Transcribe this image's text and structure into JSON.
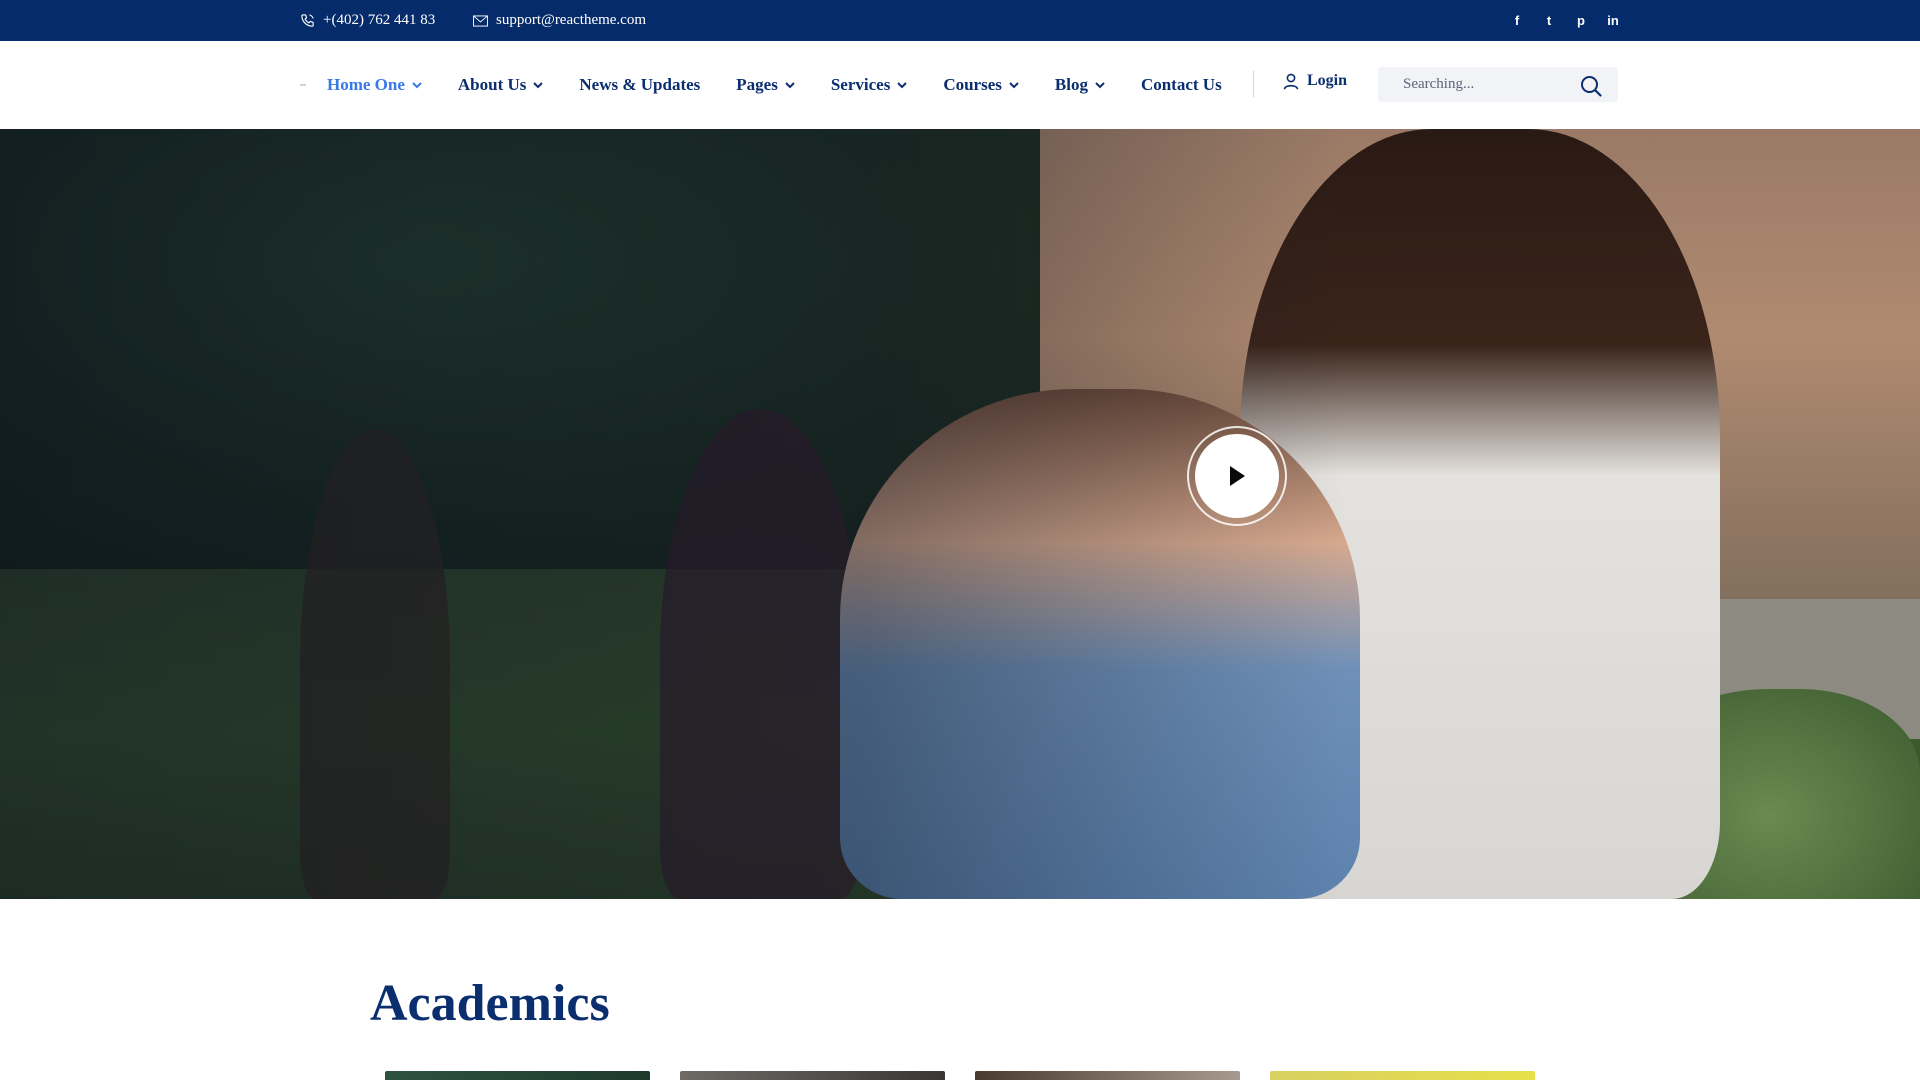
{
  "topbar": {
    "phone": "+(402) 762 441 83",
    "email": "support@reactheme.com",
    "social": [
      {
        "icon": "facebook-icon",
        "glyph": "f"
      },
      {
        "icon": "twitter-icon",
        "glyph": "t"
      },
      {
        "icon": "pinterest-icon",
        "glyph": "p"
      },
      {
        "icon": "linkedin-icon",
        "glyph": "in"
      }
    ]
  },
  "nav": {
    "items": [
      {
        "label": "Home One",
        "dropdown": true,
        "active": true
      },
      {
        "label": "About Us",
        "dropdown": true
      },
      {
        "label": "News & Updates",
        "dropdown": false
      },
      {
        "label": "Pages",
        "dropdown": true
      },
      {
        "label": "Services",
        "dropdown": true
      },
      {
        "label": "Courses",
        "dropdown": true
      },
      {
        "label": "Blog",
        "dropdown": true
      },
      {
        "label": "Contact Us",
        "dropdown": false
      }
    ],
    "login": "Login",
    "search_placeholder": "Searching..."
  },
  "hero": {
    "play_icon": "play-icon"
  },
  "academics": {
    "title": "Academics"
  },
  "colors": {
    "topbar_bg": "#062b6b",
    "primary": "#0b2e6e",
    "active": "#3a78e8"
  }
}
